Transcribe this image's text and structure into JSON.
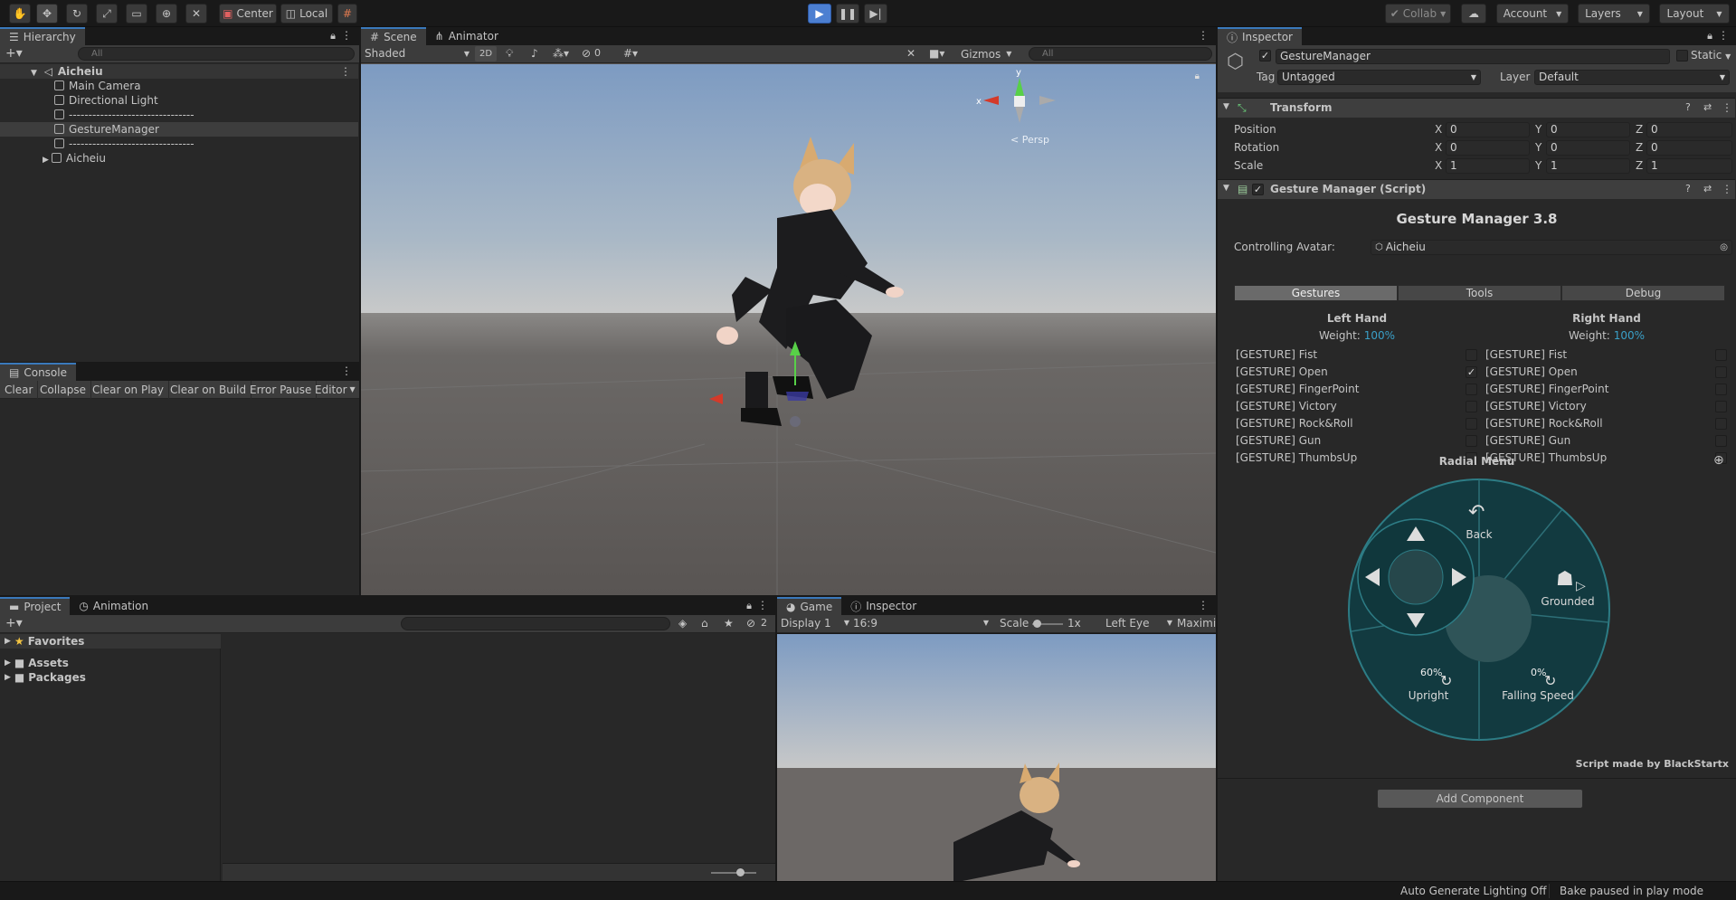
{
  "toolbar": {
    "pivot_label": "Center",
    "space_label": "Local",
    "collab_label": "Collab",
    "account_label": "Account",
    "layers_label": "Layers",
    "layout_label": "Layout"
  },
  "hierarchy": {
    "tab": "Hierarchy",
    "search_placeholder": "All",
    "scene_name": "Aicheiu",
    "items": [
      {
        "label": "Main Camera"
      },
      {
        "label": "Directional Light"
      },
      {
        "label": "--------------------------------"
      },
      {
        "label": "GestureManager"
      },
      {
        "label": "--------------------------------"
      },
      {
        "label": "Aicheiu"
      }
    ]
  },
  "console": {
    "tab": "Console",
    "buttons": [
      "Clear",
      "Collapse",
      "Clear on Play",
      "Clear on Build",
      "Error Pause",
      "Editor"
    ]
  },
  "scene": {
    "tabs": [
      "Scene",
      "Animator"
    ],
    "shading": "Shaded",
    "mode_2d": "2D",
    "hidden_count": "0",
    "gizmos": "Gizmos",
    "search_placeholder": "All",
    "persp": "< Persp",
    "axis_y": "y",
    "axis_x": "x"
  },
  "project": {
    "tabs": [
      "Project",
      "Animation"
    ],
    "favorites": "Favorites",
    "assets": "Assets",
    "packages": "Packages",
    "hidden_count": "2"
  },
  "game": {
    "tabs": [
      "Game",
      "Inspector"
    ],
    "display": "Display 1",
    "aspect": "16:9",
    "scale_label": "Scale",
    "scale_value": "1x",
    "eye": "Left Eye",
    "maximize": "Maximi"
  },
  "inspector": {
    "tab": "Inspector",
    "object_name": "GestureManager",
    "static_label": "Static",
    "tag_label": "Tag",
    "tag_value": "Untagged",
    "layer_label": "Layer",
    "layer_value": "Default",
    "transform": {
      "title": "Transform",
      "rows": [
        {
          "label": "Position",
          "x": "0",
          "y": "0",
          "z": "0"
        },
        {
          "label": "Rotation",
          "x": "0",
          "y": "0",
          "z": "0"
        },
        {
          "label": "Scale",
          "x": "1",
          "y": "1",
          "z": "1"
        }
      ]
    },
    "script": {
      "title": "Gesture Manager (Script)",
      "heading": "Gesture Manager 3.8",
      "controlling_label": "Controlling Avatar:",
      "controlling_value": "Aicheiu",
      "tabs": [
        "Gestures",
        "Tools",
        "Debug"
      ],
      "left_hand": "Left Hand",
      "right_hand": "Right Hand",
      "weight_label": "Weight:",
      "weight_left": "100%",
      "weight_right": "100%",
      "gestures": [
        "[GESTURE] Fist",
        "[GESTURE] Open",
        "[GESTURE] FingerPoint",
        "[GESTURE] Victory",
        "[GESTURE] Rock&Roll",
        "[GESTURE] Gun",
        "[GESTURE] ThumbsUp"
      ],
      "left_checked": [
        false,
        true,
        false,
        false,
        false,
        false,
        false
      ],
      "right_checked": [
        false,
        false,
        false,
        false,
        false,
        false,
        false
      ],
      "radial_title": "Radial Menu",
      "radial": {
        "back": "Back",
        "grounded": "Grounded",
        "upright": "Upright",
        "upright_value": "60%",
        "falling": "Falling Speed",
        "falling_value": "0%"
      },
      "credit": "Script made by BlackStartx"
    },
    "add_component": "Add Component"
  },
  "status": {
    "lighting": "Auto Generate Lighting Off",
    "bake": "Bake paused in play mode"
  },
  "colors": {
    "accent": "#3a79bb",
    "play_active": "#4c7fd1",
    "weight": "#3aa0c8",
    "radial": "#1e5f66"
  }
}
